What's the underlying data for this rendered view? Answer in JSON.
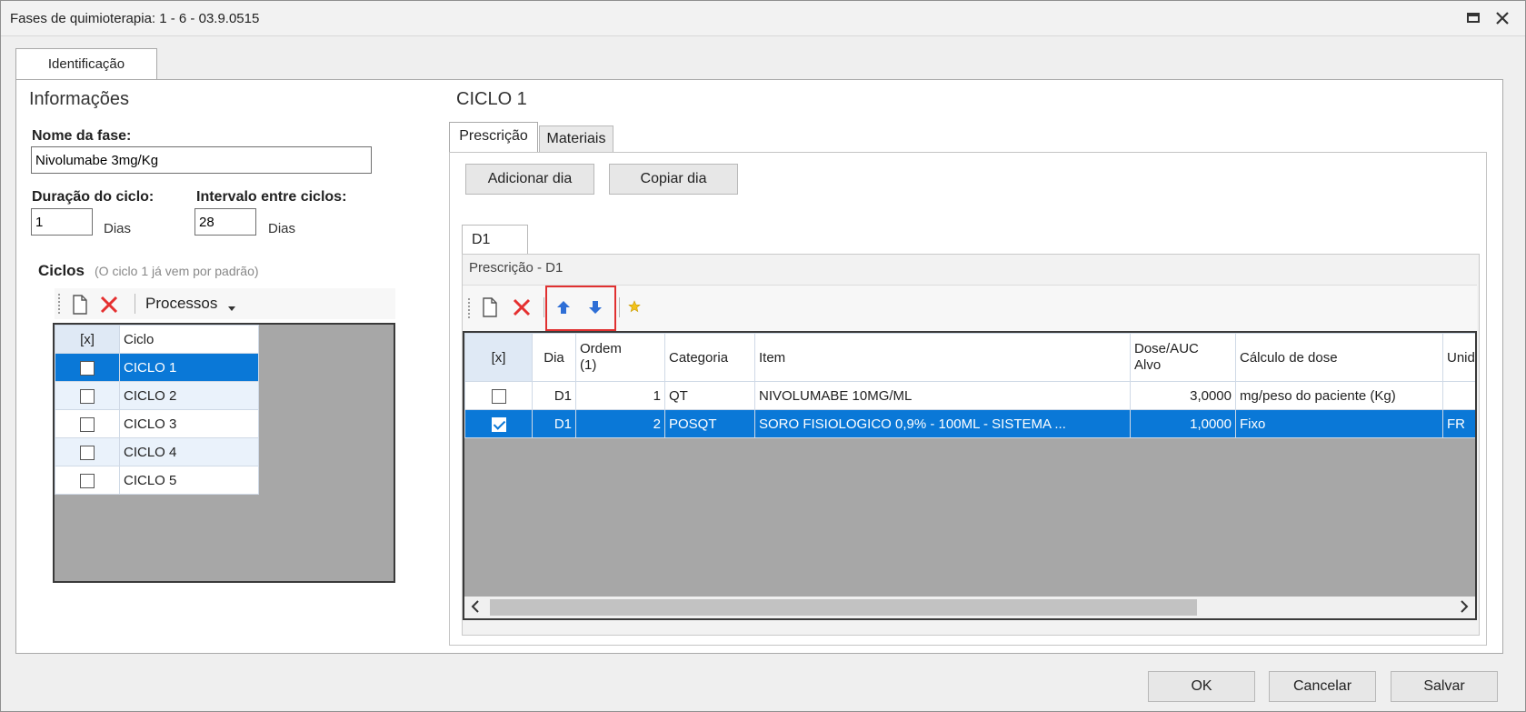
{
  "window": {
    "title": "Fases de quimioterapia: 1 - 6 - 03.9.0515"
  },
  "tabs": {
    "identificacao": "Identificação"
  },
  "left": {
    "section_title": "Informações",
    "nome_label": "Nome da fase:",
    "nome_value": "Nivolumabe 3mg/Kg",
    "duracao_label": "Duração do ciclo:",
    "duracao_value": "1",
    "duracao_unit": "Dias",
    "intervalo_label": "Intervalo entre ciclos:",
    "intervalo_value": "28",
    "intervalo_unit": "Dias",
    "ciclos_label": "Ciclos",
    "ciclos_hint": "(O ciclo 1 já vem por padrão)",
    "processos_label": "Processos",
    "grid_headers": [
      "[x]",
      "Ciclo"
    ],
    "ciclos": [
      {
        "name": "CICLO 1",
        "checked": false
      },
      {
        "name": "CICLO 2",
        "checked": false
      },
      {
        "name": "CICLO 3",
        "checked": false
      },
      {
        "name": "CICLO 4",
        "checked": false
      },
      {
        "name": "CICLO 5",
        "checked": false
      }
    ]
  },
  "right": {
    "ciclo_title": "CICLO 1",
    "tabs": [
      "Prescrição",
      "Materiais"
    ],
    "adicionar_dia": "Adicionar dia",
    "copiar_dia": "Copiar dia",
    "day_tab": "D1",
    "group_title": "Prescrição - D1",
    "grid_headers": {
      "check": "[x]",
      "dia": "Dia",
      "ordem_1": "Ordem",
      "ordem_2": "(1)",
      "categoria": "Categoria",
      "item": "Item",
      "dose_1": "Dose/AUC",
      "dose_2": "Alvo",
      "calculo": "Cálculo de dose",
      "unidade": "Unid"
    },
    "rows": [
      {
        "checked": false,
        "dia": "D1",
        "ordem": "1",
        "categoria": "QT",
        "item": "NIVOLUMABE 10MG/ML",
        "dose": "3,0000",
        "calculo": "mg/peso do paciente (Kg)",
        "unidade": ""
      },
      {
        "checked": true,
        "dia": "D1",
        "ordem": "2",
        "categoria": "POSQT",
        "item": "SORO FISIOLOGICO 0,9% - 100ML - SISTEMA  ...",
        "dose": "1,0000",
        "calculo": "Fixo",
        "unidade": "FR"
      }
    ]
  },
  "footer": {
    "ok": "OK",
    "cancelar": "Cancelar",
    "salvar": "Salvar"
  },
  "colors": {
    "selection": "#0a78d7",
    "highlight_box": "#e03030",
    "delete_red": "#e53030",
    "arrow_blue": "#2f6fd6"
  }
}
